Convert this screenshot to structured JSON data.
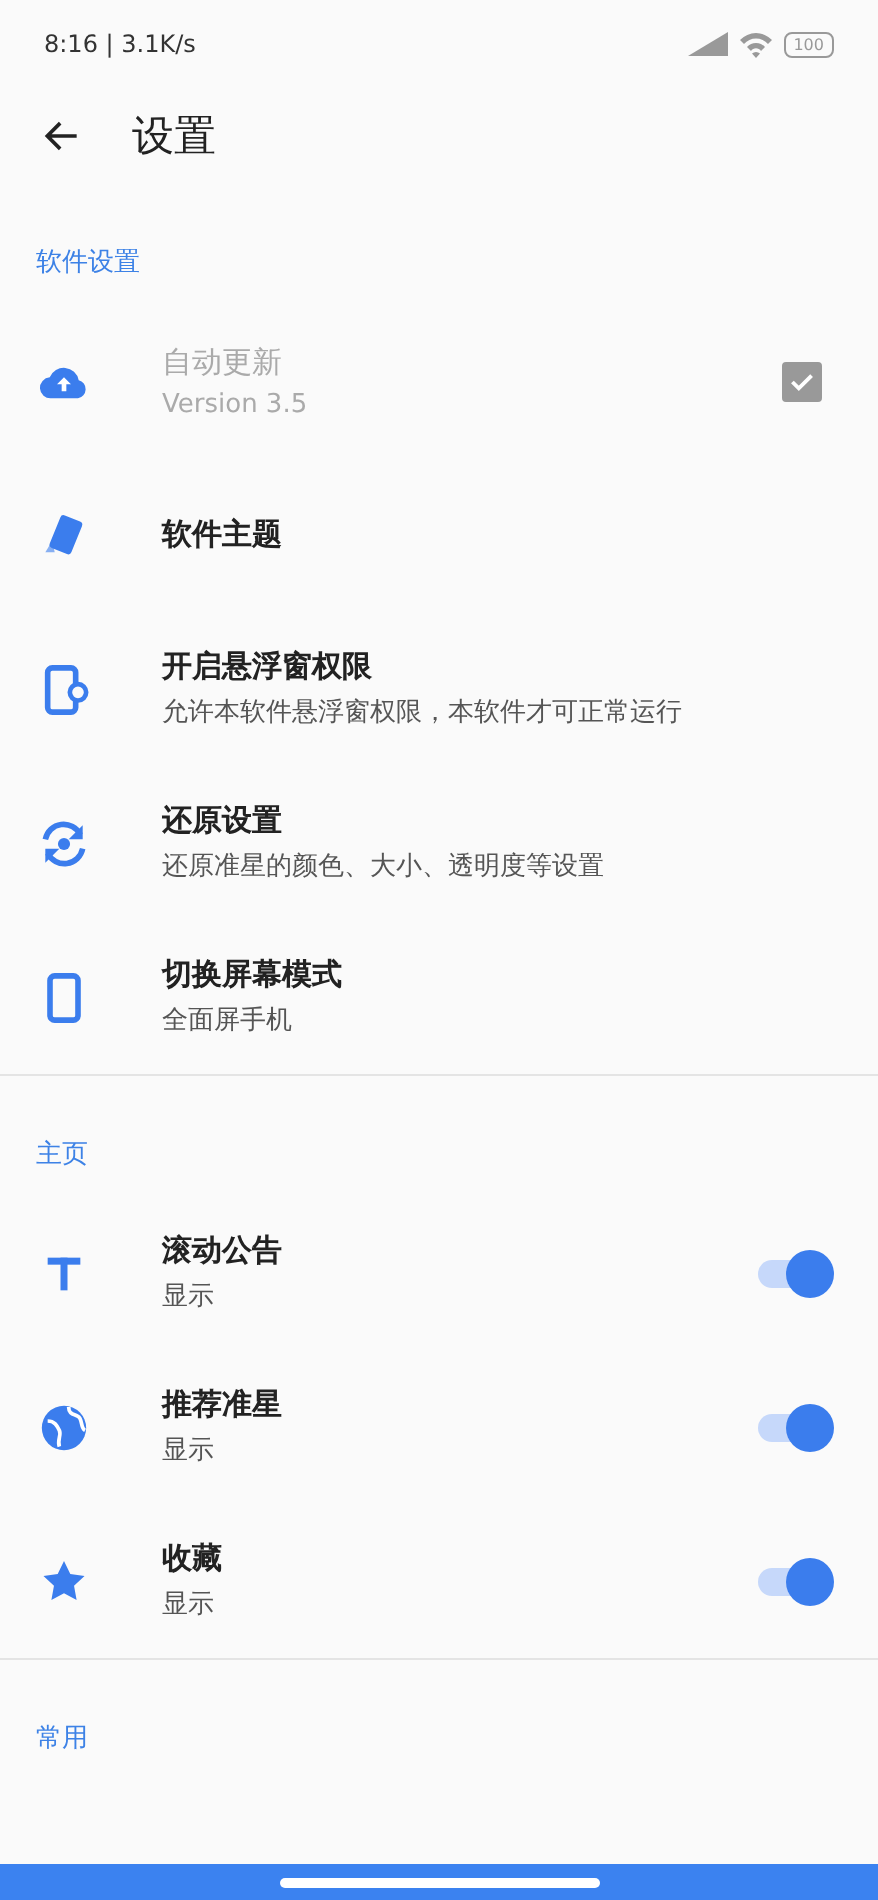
{
  "status_bar": {
    "time": "8:16 | 3.1K/s",
    "battery": "100"
  },
  "header": {
    "title": "设置"
  },
  "sections": [
    {
      "title": "软件设置",
      "items": [
        {
          "title": "自动更新",
          "subtitle": "Version 3.5",
          "disabled": true,
          "kind": "checkbox",
          "checked": true
        },
        {
          "title": "软件主题",
          "disabled": false,
          "kind": "plain"
        },
        {
          "title": "开启悬浮窗权限",
          "subtitle": "允许本软件悬浮窗权限，本软件才可正常运行",
          "disabled": false,
          "kind": "plain"
        },
        {
          "title": "还原设置",
          "subtitle": "还原准星的颜色、大小、透明度等设置",
          "disabled": false,
          "kind": "plain"
        },
        {
          "title": "切换屏幕模式",
          "subtitle": "全面屏手机",
          "disabled": false,
          "kind": "plain"
        }
      ]
    },
    {
      "title": "主页",
      "items": [
        {
          "title": "滚动公告",
          "subtitle": "显示",
          "disabled": false,
          "kind": "switch",
          "on": true
        },
        {
          "title": "推荐准星",
          "subtitle": "显示",
          "disabled": false,
          "kind": "switch",
          "on": true
        },
        {
          "title": "收藏",
          "subtitle": "显示",
          "disabled": false,
          "kind": "switch",
          "on": true
        }
      ]
    },
    {
      "title": "常用"
    }
  ]
}
